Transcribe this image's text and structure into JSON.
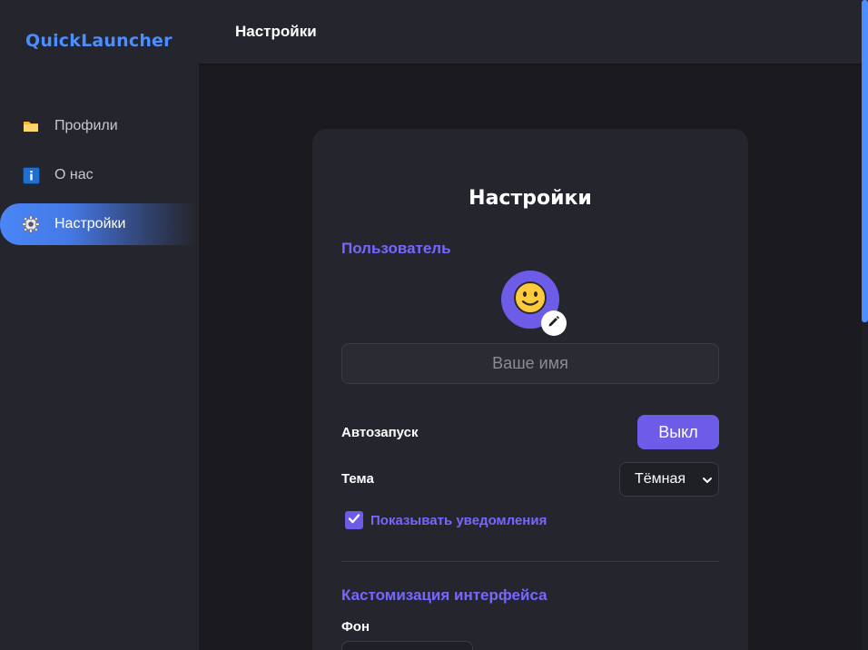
{
  "app": {
    "brand": "QuickLauncher"
  },
  "header": {
    "title": "Настройки"
  },
  "sidebar": {
    "items": [
      {
        "label": "Профили",
        "icon": "folder-icon",
        "active": false
      },
      {
        "label": "О нас",
        "icon": "info-icon",
        "active": false
      },
      {
        "label": "Настройки",
        "icon": "gear-icon",
        "active": true
      }
    ]
  },
  "settings": {
    "title": "Настройки",
    "user_section": "Пользователь",
    "avatar_emoji": "🙂",
    "name_placeholder": "Ваше имя",
    "name_value": "",
    "autostart_label": "Автозапуск",
    "autostart_value": "Выкл",
    "theme_label": "Тема",
    "theme_value": "Тёмная",
    "notifications_label": "Показывать уведомления",
    "notifications_checked": true,
    "customization_section": "Кастомизация интерфейса",
    "background_label": "Фон"
  },
  "colors": {
    "accent": "#6c5ce7",
    "brand": "#4c8dff",
    "section_title": "#7667ff",
    "background": "#1b1b1f",
    "panel": "#25262d"
  }
}
